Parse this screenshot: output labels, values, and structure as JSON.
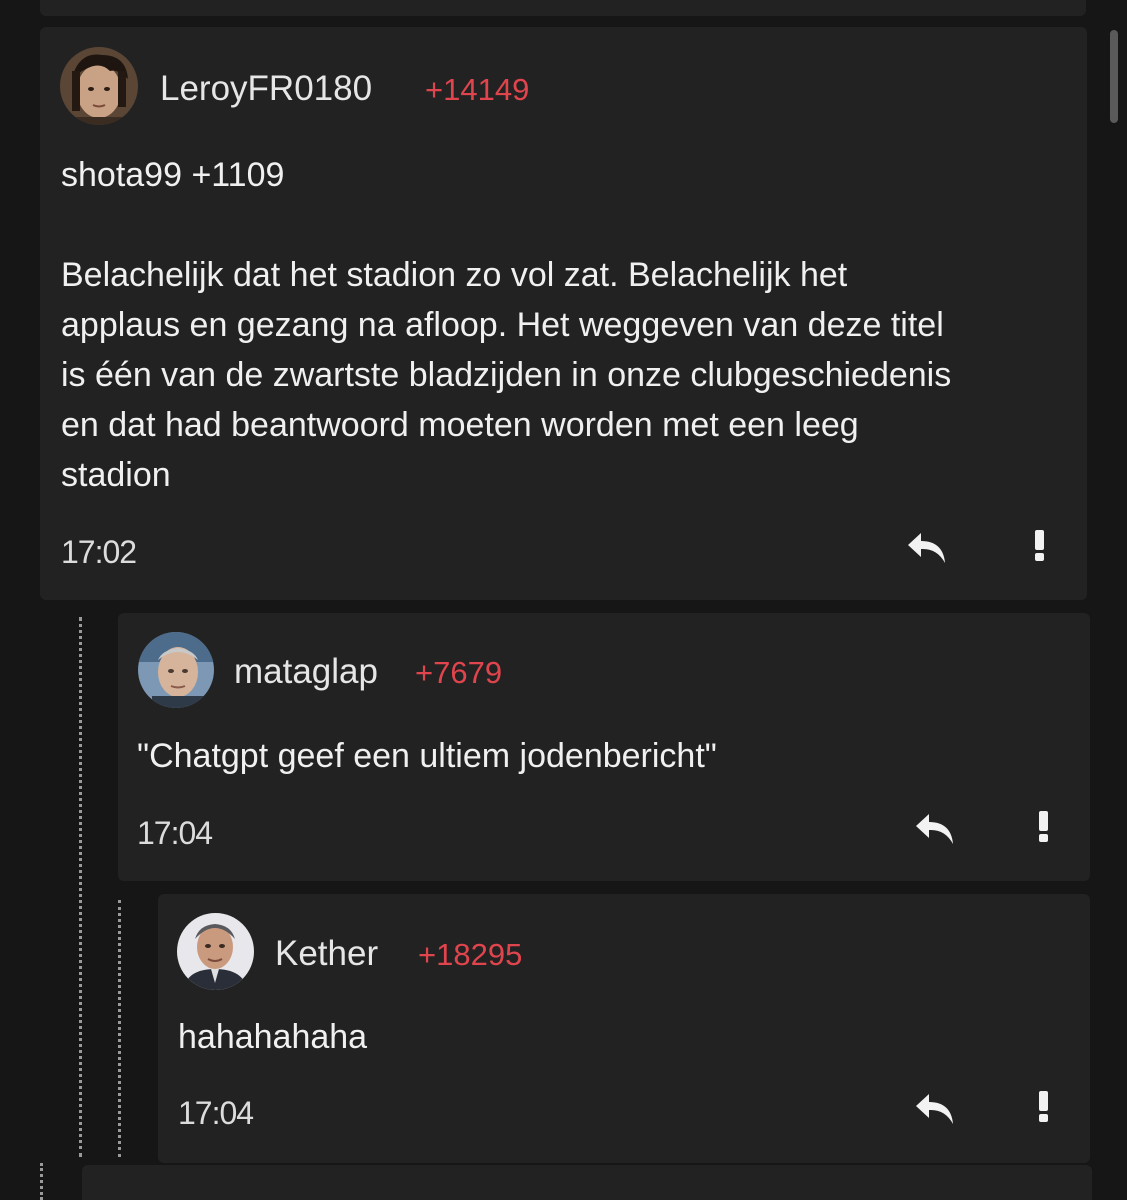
{
  "comments": [
    {
      "username": "LeroyFR0180",
      "karma": "+14149",
      "quote_header": "shota99 +1109",
      "text": "Belachelijk dat het stadion zo vol zat. Belachelijk het\napplaus en gezang na afloop. Het weggeven van deze titel\nis één van de zwartste bladzijden in onze clubgeschiedenis\nen dat had beantwoord moeten worden met een leeg\nstadion",
      "time": "17:02"
    },
    {
      "username": "mataglap",
      "karma": "+7679",
      "text": "\"Chatgpt geef een ultiem jodenbericht\"",
      "time": "17:04"
    },
    {
      "username": "Kether",
      "karma": "+18295",
      "text": "hahahahaha",
      "time": "17:04"
    }
  ],
  "icons": {
    "reply": "reply-arrow-icon",
    "report": "exclamation-icon"
  },
  "colors": {
    "background": "#161616",
    "card": "#222222",
    "karma": "#e0444c",
    "text": "#f0f0f0"
  }
}
